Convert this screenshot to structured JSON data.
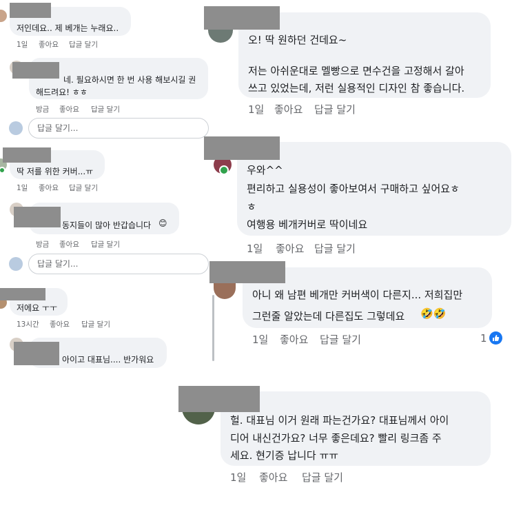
{
  "left": {
    "thread1": {
      "comment_text": "저인데요.. 제 베개는 누래요..",
      "time": "1일",
      "like": "좋아요",
      "reply": "답글 달기",
      "reply_comment": {
        "line1": "네. 필요하시면 한 번 사용 해보시길 권",
        "line2": "해드려요! ㅎㅎ",
        "time": "방금",
        "like": "좋아요",
        "reply": "답글 달기"
      },
      "reply_placeholder": "답글 달기..."
    },
    "thread2": {
      "comment_text": "딱 저를 위한 커버...ㅠ",
      "time": "1일",
      "like": "좋아요",
      "reply": "답글 달기",
      "reply_comment": {
        "text": "동지들이 많아 반갑습니다",
        "emoji": "😊",
        "time": "방금",
        "like": "좋아요",
        "reply": "답글 달기"
      },
      "reply_placeholder": "답글 달기..."
    },
    "thread3": {
      "comment_text": "저에요 ㅜㅜ",
      "time": "13시간",
      "like": "좋아요",
      "reply": "답글 달기",
      "reply_comment": {
        "text": "아이고 대표님.... 반가워요"
      }
    }
  },
  "right": {
    "c1": {
      "line1": "오! 딱 원하던 건데요~",
      "line2": "저는 아쉬운대로 멜빵으로 면수건을 고정해서 갈아",
      "line3": "쓰고 있었는데, 저런 실용적인 디자인 참 좋습니다.",
      "time": "1일",
      "like": "좋아요",
      "reply": "답글 달기"
    },
    "c2": {
      "line1": "우와^^",
      "line2": "편리하고 실용성이 좋아보여서 구매하고 싶어요ㅎ",
      "line3": "ㅎ",
      "line4": "여행용 베개커버로 딱이네요",
      "time": "1일",
      "like": "좋아요",
      "reply": "답글 달기"
    },
    "c3": {
      "line1": "아니 왜 남편 베개만 커버색이 다른지... 저희집만",
      "line2": "그런줄 알았는데 다른집도 그렇데요",
      "emoji": "🤣🤣",
      "time": "1일",
      "like": "좋아요",
      "reply": "답글 달기",
      "like_count": "1",
      "like_color": "#1877f2"
    },
    "c4": {
      "line1": "헐. 대표님 이거 원래 파는건가요? 대표님께서 아이",
      "line2": "디어 내신건가요? 너무 좋은데요? 빨리 링크좀 주",
      "line3": "세요. 현기증 납니다 ㅠㅠ",
      "time": "1일",
      "like": "좋아요",
      "reply": "답글 달기"
    }
  },
  "colors": {
    "bubble": "#f0f2f5",
    "meta": "#65676b",
    "online": "#31a24c",
    "like_blue": "#1877f2"
  }
}
